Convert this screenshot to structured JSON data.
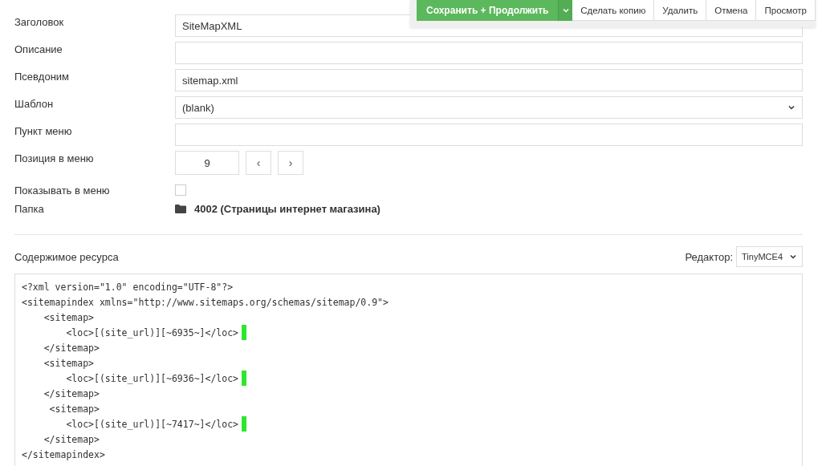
{
  "toolbar": {
    "primary": "Сохранить + Продолжить",
    "buttons": [
      "Сделать копию",
      "Удалить",
      "Отмена",
      "Просмотр"
    ]
  },
  "fields": [
    {
      "kind": "text",
      "label": "Заголовок",
      "value": "SiteMapXML"
    },
    {
      "kind": "text",
      "label": "Описание"
    },
    {
      "kind": "text",
      "label": "Псевдоним",
      "value": "sitemap.xml"
    },
    {
      "kind": "select",
      "label": "Шаблон",
      "value": "(blank)"
    },
    {
      "kind": "text",
      "label": "Пункт меню"
    },
    {
      "kind": "stepper",
      "label": "Позиция в меню",
      "value": "9",
      "prev": "‹",
      "next": "›"
    },
    {
      "kind": "checkbox",
      "label": "Показывать в меню",
      "checked": false
    },
    {
      "kind": "folder",
      "label": "Папка",
      "value": "4002 (Страницы интернет магазина)"
    }
  ],
  "content": {
    "label": "Содержимое ресурса",
    "editor_label": "Редактор:",
    "editor": "TinyMCE4",
    "lines": [
      {
        "text": "<?xml version=\"1.0\" encoding=\"UTF-8\"?>",
        "marked": false
      },
      {
        "text": "<sitemapindex xmlns=\"http://www.sitemaps.org/schemas/sitemap/0.9\">",
        "marked": false
      },
      {
        "text": "    <sitemap>",
        "marked": false
      },
      {
        "text": "        <loc>[(site_url)][~6935~]</loc>",
        "marked": true
      },
      {
        "text": "    </sitemap>",
        "marked": false
      },
      {
        "text": "    <sitemap>",
        "marked": false
      },
      {
        "text": "        <loc>[(site_url)][~6936~]</loc>",
        "marked": true
      },
      {
        "text": "    </sitemap>",
        "marked": false
      },
      {
        "text": "     <sitemap>",
        "marked": false
      },
      {
        "text": "        <loc>[(site_url)][~7417~]</loc>",
        "marked": true
      },
      {
        "text": "    </sitemap>",
        "marked": false
      },
      {
        "text": "</sitemapindex>",
        "marked": false
      }
    ]
  }
}
